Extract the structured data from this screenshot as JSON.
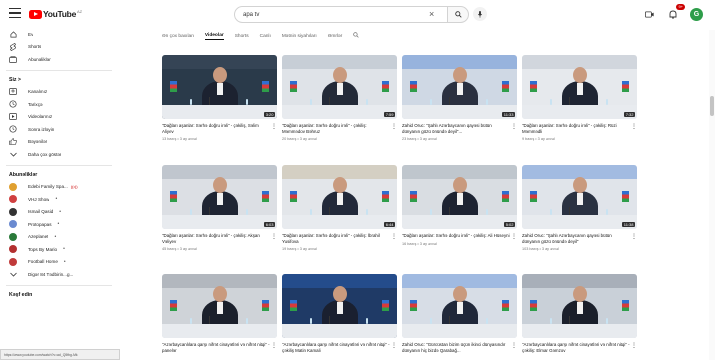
{
  "topbar": {
    "logo_text": "YouTube",
    "logo_region": "AZ",
    "search_value": "apa tv",
    "clear_symbol": "×",
    "notifications_badge": "9+",
    "create_label": "",
    "avatar_letter": "G"
  },
  "sidebar": {
    "main": [
      {
        "label": "Ev",
        "icon": "home-icon"
      },
      {
        "label": "Shorts",
        "icon": "shorts-icon"
      },
      {
        "label": "Abunəliklər",
        "icon": "subscriptions-icon"
      }
    ],
    "you_header": "Siz >",
    "you": [
      {
        "label": "Kanalınız",
        "icon": "channel-icon"
      },
      {
        "label": "Tarixçə",
        "icon": "history-icon"
      },
      {
        "label": "Videolarınız",
        "icon": "your-videos-icon"
      },
      {
        "label": "Sonra izləyin",
        "icon": "watch-later-icon"
      },
      {
        "label": "Bəyənilər",
        "icon": "liked-icon"
      },
      {
        "label": "Daha çox göstər",
        "icon": "chevron-down-icon"
      }
    ],
    "subs_header": "Abunəliklər",
    "subs": [
      {
        "label": "Edebi Family Spa...",
        "color": "#e0a030",
        "live": true
      },
      {
        "label": "VHJ Show",
        "color": "#d04040",
        "live": false
      },
      {
        "label": "Ismail Qasid",
        "color": "#333333",
        "live": false
      },
      {
        "label": "Protopapas",
        "color": "#6a8ad0",
        "live": false
      },
      {
        "label": "Azeplanet",
        "color": "#2a7a3a",
        "live": false
      },
      {
        "label": "Tops By Mario",
        "color": "#b33030",
        "live": false
      },
      {
        "label": "Football Home",
        "color": "#c03a3a",
        "live": false
      },
      {
        "label": "Digər 84 Tədbirin...g...",
        "color": "",
        "live": false
      }
    ],
    "explore_header": "Kəşf edin",
    "status_url": "https://www.youtube.com/watch?v=ad_Q5fbg-Mk"
  },
  "chips": [
    "Ən çox baxılan",
    "Videolar",
    "Shorts",
    "Canlı",
    "Mətnin siyahıları",
    "Əmrlər"
  ],
  "videos": [
    {
      "title": "\"Dağları aşanlar: Sərhə doğru irəli\" - çəkiliş, Səlim Aliyev",
      "meta": "13 baxış • 3 ay əvvəl",
      "duration": "3:20",
      "scene": "a"
    },
    {
      "title": "\"Dağları aşanlar: Sərhə doğru irəli\" - çəkiliş: Məmmədov Bəhruz",
      "meta": "20 baxış • 3 ay əvvəl",
      "duration": "7:59",
      "scene": "b"
    },
    {
      "title": "Zahid Oruc: \"Şahlı Azərbaycanın qayəsi bütün dünyanın gözü önündə deyil\"...",
      "meta": "23 baxış • 3 ay əvvəl",
      "duration": "11:33",
      "scene": "c"
    },
    {
      "title": "\"Dağları aşanlar: Sərhə doğru irəli\" - çəkiliş: Rüzi Məmmədli",
      "meta": "9 baxış • 3 ay əvvəl",
      "duration": "7:32",
      "scene": "d"
    },
    {
      "title": "\"Dağları aşanlar: Sərhə doğru irəli\" - çəkiliş: Akşan Vəliyev",
      "meta": "45 baxış • 3 ay əvvəl",
      "duration": "6:03",
      "scene": "e"
    },
    {
      "title": "\"Dağları aşanlar: Sərhə doğru irəli\" - çəkiliş: İbrahil Yusifova",
      "meta": "19 baxış • 3 ay əvvəl",
      "duration": "6:44",
      "scene": "f"
    },
    {
      "title": "\"Dağları aşanlar: Sərhə doğru irəli\" - çəkiliş: Ali Hüseyni",
      "meta": "16 baxış • 3 ay əvvəl",
      "duration": "5:02",
      "scene": "g"
    },
    {
      "title": "Zahid Oruc: \"Şahlı Azərbaycanın qayəsi bütün dünyanın gözü önündə deyil\"",
      "meta": "103 baxış • 3 ay əvvəl",
      "duration": "11:38",
      "scene": "h"
    },
    {
      "title": "\"Azərbaycanlılara qarşı nifrət cinayətləri və nifrət nitqi\" - panelər",
      "meta": "",
      "duration": "",
      "scene": "i"
    },
    {
      "title": "\"Azərbaycanlılara qarşı nifrət cinayətləri və nifrət nitqi\" - çəkiliş Matin Kamali",
      "meta": "",
      "duration": "",
      "scene": "j"
    },
    {
      "title": "Zahid Oruc: \"Gürcüstan bizim üçün ikinci dünyasındır dünyanın hiç bizdə Qarabağ...",
      "meta": "",
      "duration": "",
      "scene": "k"
    },
    {
      "title": "\"Azərbaycanlılara qarşı nifrət cinayətləri və nifrət nitqi\" - çəkiliş: Elmar Gəmzov",
      "meta": "",
      "duration": "",
      "scene": "l"
    }
  ],
  "colors": {
    "brand": "#ff0000",
    "avatar": "#2e9d4a",
    "az_blue": "#2f6fd0",
    "az_red": "#d83a3a",
    "az_green": "#2e9d4a"
  }
}
